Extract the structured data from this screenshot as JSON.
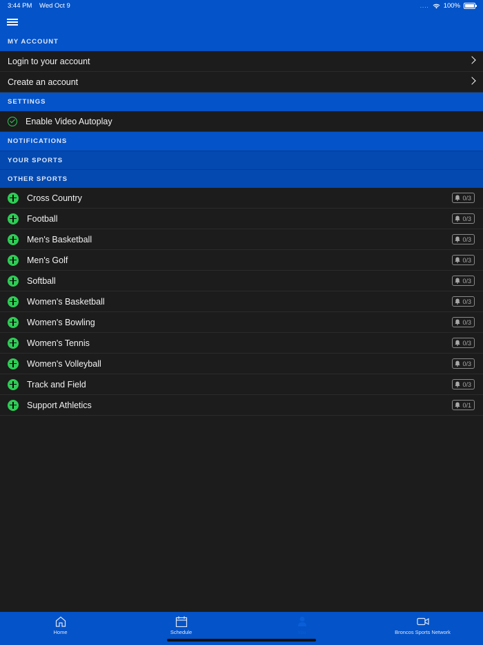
{
  "status_bar": {
    "time": "3:44 PM",
    "date": "Wed Oct 9",
    "signal": "....",
    "battery": "100%"
  },
  "sections": {
    "my_account": "MY ACCOUNT",
    "settings": "SETTINGS",
    "notifications": "NOTIFICATIONS",
    "your_sports": "YOUR SPORTS",
    "other_sports": "OTHER SPORTS"
  },
  "account_items": [
    {
      "label": "Login to your account"
    },
    {
      "label": "Create an account"
    }
  ],
  "settings_items": [
    {
      "label": "Enable Video Autoplay",
      "enabled": true
    }
  ],
  "other_sports": [
    {
      "label": "Cross Country",
      "badge": "0/3"
    },
    {
      "label": "Football",
      "badge": "0/3"
    },
    {
      "label": "Men's Basketball",
      "badge": "0/3"
    },
    {
      "label": "Men's Golf",
      "badge": "0/3"
    },
    {
      "label": "Softball",
      "badge": "0/3"
    },
    {
      "label": "Women's Basketball",
      "badge": "0/3"
    },
    {
      "label": "Women's Bowling",
      "badge": "0/3"
    },
    {
      "label": "Women's Tennis",
      "badge": "0/3"
    },
    {
      "label": "Women's Volleyball",
      "badge": "0/3"
    },
    {
      "label": "Track and Field",
      "badge": "0/3"
    },
    {
      "label": "Support Athletics",
      "badge": "0/1"
    }
  ],
  "tabs": [
    {
      "label": "Home",
      "icon": "home-icon"
    },
    {
      "label": "Schedule",
      "icon": "calendar-icon"
    },
    {
      "label": "You",
      "icon": "person-icon",
      "active": true
    },
    {
      "label": "Broncos Sports Network",
      "icon": "video-camera-icon"
    }
  ],
  "colors": {
    "brand_blue": "#0453c8",
    "accent_green": "#2ecc55",
    "background": "#1c1c1c"
  }
}
